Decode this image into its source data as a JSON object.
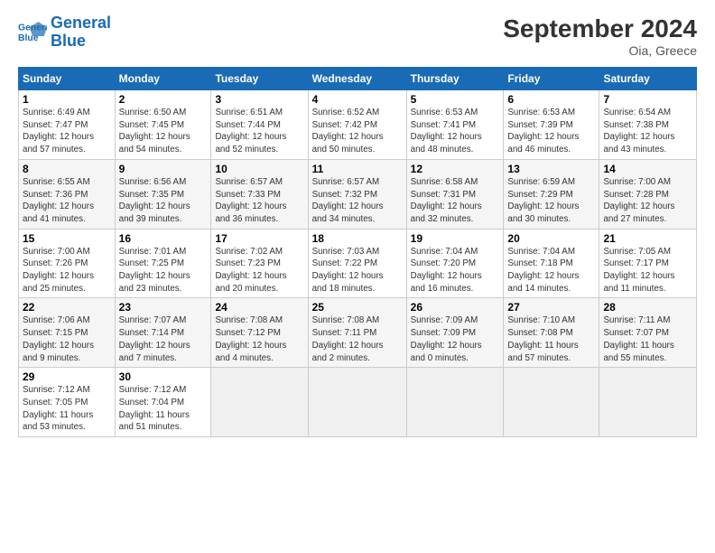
{
  "logo": {
    "line1": "General",
    "line2": "Blue"
  },
  "title": "September 2024",
  "location": "Oia, Greece",
  "days_of_week": [
    "Sunday",
    "Monday",
    "Tuesday",
    "Wednesday",
    "Thursday",
    "Friday",
    "Saturday"
  ],
  "weeks": [
    [
      {
        "day": "1",
        "info": "Sunrise: 6:49 AM\nSunset: 7:47 PM\nDaylight: 12 hours\nand 57 minutes."
      },
      {
        "day": "2",
        "info": "Sunrise: 6:50 AM\nSunset: 7:45 PM\nDaylight: 12 hours\nand 54 minutes."
      },
      {
        "day": "3",
        "info": "Sunrise: 6:51 AM\nSunset: 7:44 PM\nDaylight: 12 hours\nand 52 minutes."
      },
      {
        "day": "4",
        "info": "Sunrise: 6:52 AM\nSunset: 7:42 PM\nDaylight: 12 hours\nand 50 minutes."
      },
      {
        "day": "5",
        "info": "Sunrise: 6:53 AM\nSunset: 7:41 PM\nDaylight: 12 hours\nand 48 minutes."
      },
      {
        "day": "6",
        "info": "Sunrise: 6:53 AM\nSunset: 7:39 PM\nDaylight: 12 hours\nand 46 minutes."
      },
      {
        "day": "7",
        "info": "Sunrise: 6:54 AM\nSunset: 7:38 PM\nDaylight: 12 hours\nand 43 minutes."
      }
    ],
    [
      {
        "day": "8",
        "info": "Sunrise: 6:55 AM\nSunset: 7:36 PM\nDaylight: 12 hours\nand 41 minutes."
      },
      {
        "day": "9",
        "info": "Sunrise: 6:56 AM\nSunset: 7:35 PM\nDaylight: 12 hours\nand 39 minutes."
      },
      {
        "day": "10",
        "info": "Sunrise: 6:57 AM\nSunset: 7:33 PM\nDaylight: 12 hours\nand 36 minutes."
      },
      {
        "day": "11",
        "info": "Sunrise: 6:57 AM\nSunset: 7:32 PM\nDaylight: 12 hours\nand 34 minutes."
      },
      {
        "day": "12",
        "info": "Sunrise: 6:58 AM\nSunset: 7:31 PM\nDaylight: 12 hours\nand 32 minutes."
      },
      {
        "day": "13",
        "info": "Sunrise: 6:59 AM\nSunset: 7:29 PM\nDaylight: 12 hours\nand 30 minutes."
      },
      {
        "day": "14",
        "info": "Sunrise: 7:00 AM\nSunset: 7:28 PM\nDaylight: 12 hours\nand 27 minutes."
      }
    ],
    [
      {
        "day": "15",
        "info": "Sunrise: 7:00 AM\nSunset: 7:26 PM\nDaylight: 12 hours\nand 25 minutes."
      },
      {
        "day": "16",
        "info": "Sunrise: 7:01 AM\nSunset: 7:25 PM\nDaylight: 12 hours\nand 23 minutes."
      },
      {
        "day": "17",
        "info": "Sunrise: 7:02 AM\nSunset: 7:23 PM\nDaylight: 12 hours\nand 20 minutes."
      },
      {
        "day": "18",
        "info": "Sunrise: 7:03 AM\nSunset: 7:22 PM\nDaylight: 12 hours\nand 18 minutes."
      },
      {
        "day": "19",
        "info": "Sunrise: 7:04 AM\nSunset: 7:20 PM\nDaylight: 12 hours\nand 16 minutes."
      },
      {
        "day": "20",
        "info": "Sunrise: 7:04 AM\nSunset: 7:18 PM\nDaylight: 12 hours\nand 14 minutes."
      },
      {
        "day": "21",
        "info": "Sunrise: 7:05 AM\nSunset: 7:17 PM\nDaylight: 12 hours\nand 11 minutes."
      }
    ],
    [
      {
        "day": "22",
        "info": "Sunrise: 7:06 AM\nSunset: 7:15 PM\nDaylight: 12 hours\nand 9 minutes."
      },
      {
        "day": "23",
        "info": "Sunrise: 7:07 AM\nSunset: 7:14 PM\nDaylight: 12 hours\nand 7 minutes."
      },
      {
        "day": "24",
        "info": "Sunrise: 7:08 AM\nSunset: 7:12 PM\nDaylight: 12 hours\nand 4 minutes."
      },
      {
        "day": "25",
        "info": "Sunrise: 7:08 AM\nSunset: 7:11 PM\nDaylight: 12 hours\nand 2 minutes."
      },
      {
        "day": "26",
        "info": "Sunrise: 7:09 AM\nSunset: 7:09 PM\nDaylight: 12 hours\nand 0 minutes."
      },
      {
        "day": "27",
        "info": "Sunrise: 7:10 AM\nSunset: 7:08 PM\nDaylight: 11 hours\nand 57 minutes."
      },
      {
        "day": "28",
        "info": "Sunrise: 7:11 AM\nSunset: 7:07 PM\nDaylight: 11 hours\nand 55 minutes."
      }
    ],
    [
      {
        "day": "29",
        "info": "Sunrise: 7:12 AM\nSunset: 7:05 PM\nDaylight: 11 hours\nand 53 minutes."
      },
      {
        "day": "30",
        "info": "Sunrise: 7:12 AM\nSunset: 7:04 PM\nDaylight: 11 hours\nand 51 minutes."
      },
      {
        "day": "",
        "info": ""
      },
      {
        "day": "",
        "info": ""
      },
      {
        "day": "",
        "info": ""
      },
      {
        "day": "",
        "info": ""
      },
      {
        "day": "",
        "info": ""
      }
    ]
  ]
}
